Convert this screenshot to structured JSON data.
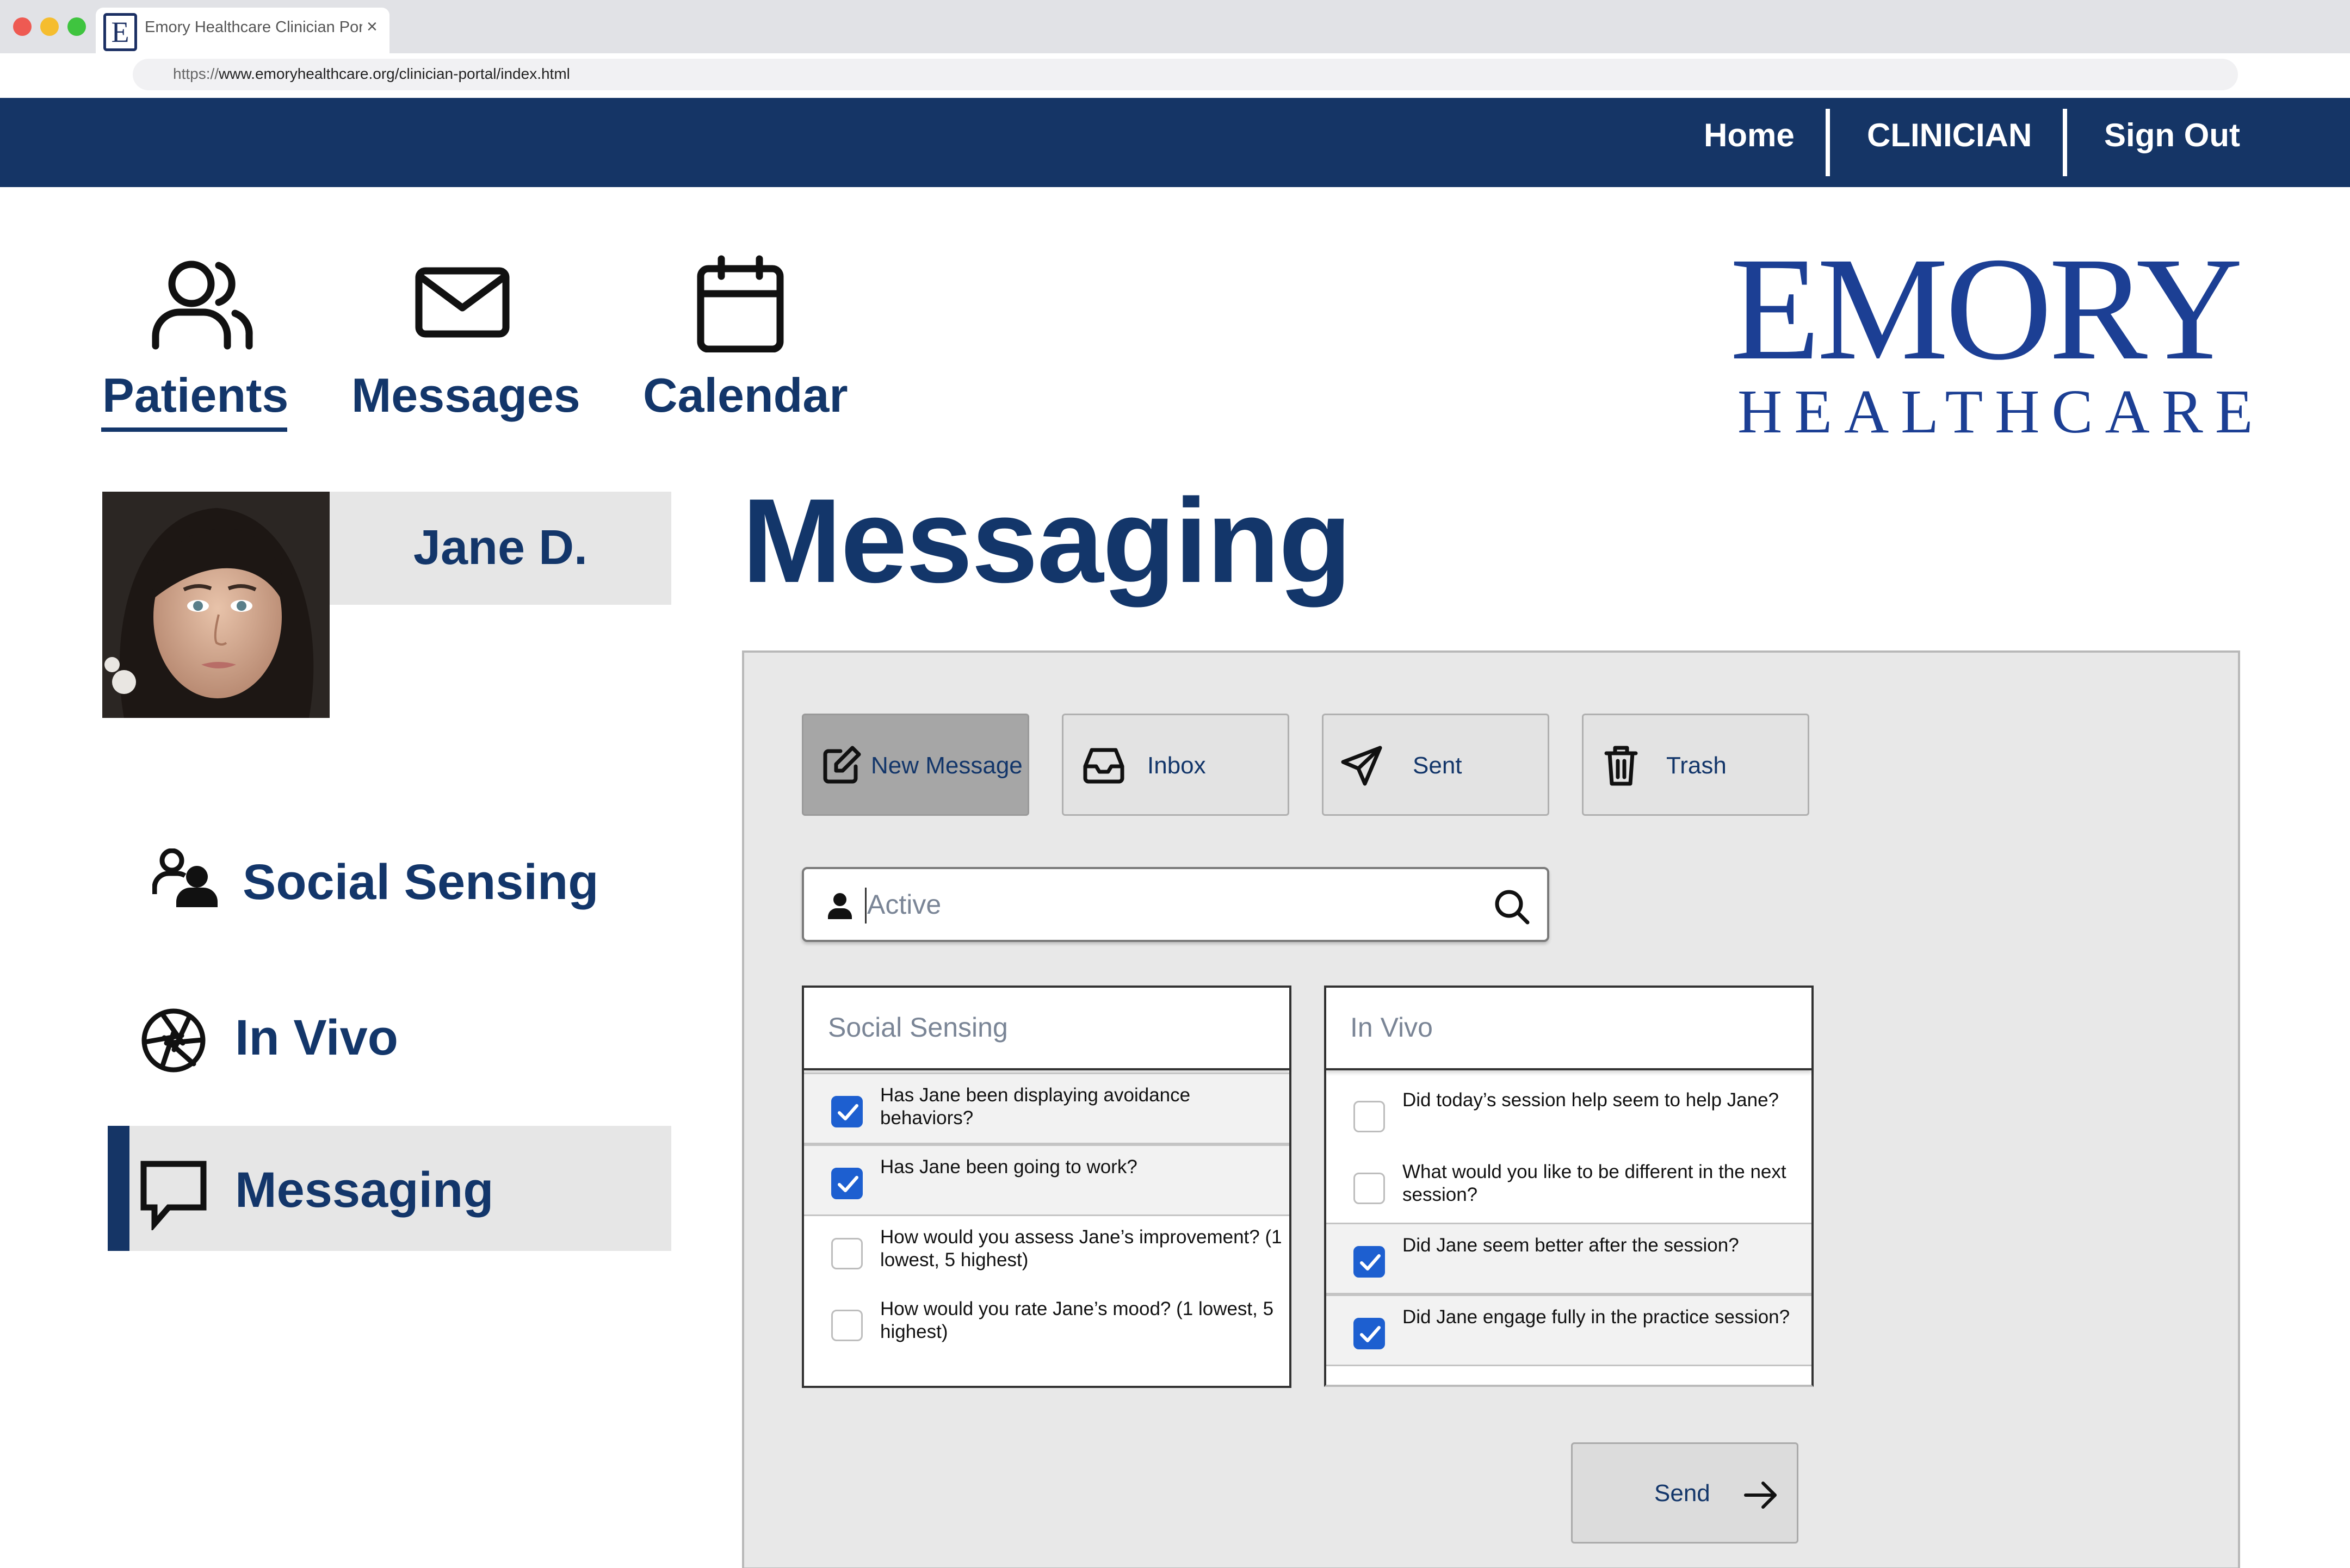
{
  "browser": {
    "tab_title": "Emory Healthcare Clinician Por",
    "favicon_letter": "E",
    "url_protocol": "https://",
    "url_rest": "www.emoryhealthcare.org/clinician-portal/index.html"
  },
  "topnav": {
    "home": "Home",
    "clinician": "CLINICIAN",
    "signout": "Sign Out",
    "background_color": "#153566"
  },
  "main_tabs": {
    "patients": "Patients",
    "messages": "Messages",
    "calendar": "Calendar",
    "active": "Patients"
  },
  "logo": {
    "line1": "EMORY",
    "line2": "HEALTHCARE",
    "color": "#1c3f94"
  },
  "patient": {
    "name": "Jane D."
  },
  "sidenav": {
    "social_sensing": "Social Sensing",
    "in_vivo": "In Vivo",
    "messaging": "Messaging",
    "active": "Messaging"
  },
  "page_title": "Messaging",
  "toolbar": {
    "new_message": "New Message",
    "inbox": "Inbox",
    "sent": "Sent",
    "trash": "Trash",
    "active": "New Message"
  },
  "search": {
    "placeholder": "Active"
  },
  "social_sensing_panel": {
    "header": "Social Sensing",
    "items": [
      {
        "text": "Has Jane been displaying avoidance behaviors?",
        "checked": true
      },
      {
        "text": "Has Jane been going to work?",
        "checked": true
      },
      {
        "text": "How would you assess Jane’s improvement? (1 lowest, 5 highest)",
        "checked": false
      },
      {
        "text": "How would you rate Jane’s mood? (1 lowest, 5 highest)",
        "checked": false
      }
    ]
  },
  "in_vivo_panel": {
    "header": "In Vivo",
    "items": [
      {
        "text": "Did today’s session help seem to help Jane?",
        "checked": false
      },
      {
        "text": "What would you like to be different in the next session?",
        "checked": false
      },
      {
        "text": "Did Jane seem better after the session?",
        "checked": true
      },
      {
        "text": "Did Jane engage fully in the practice session?",
        "checked": true
      }
    ]
  },
  "send_button": "Send",
  "colors": {
    "primary": "#13366a",
    "checkbox": "#1d5fd0"
  }
}
